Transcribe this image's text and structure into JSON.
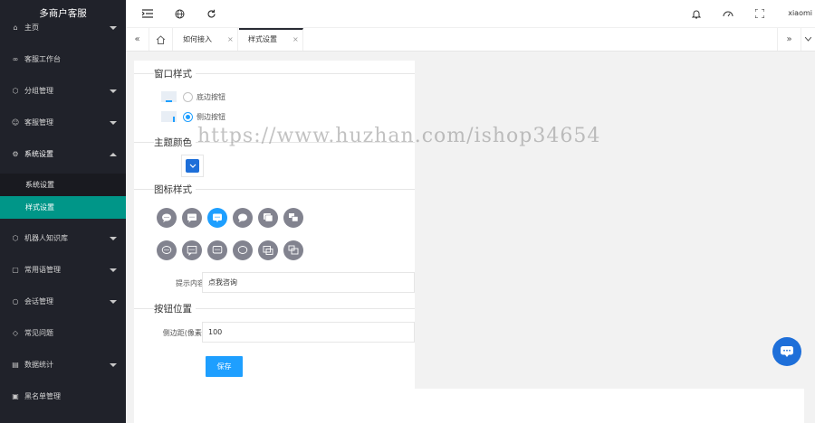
{
  "sidebar": {
    "logo": "多商户客服",
    "items": [
      {
        "label": "主页",
        "icon": "home-icon",
        "arrow": "down"
      },
      {
        "label": "客服工作台",
        "icon": "link-icon",
        "arrow": ""
      },
      {
        "label": "分组管理",
        "icon": "cube-icon",
        "arrow": "down"
      },
      {
        "label": "客服管理",
        "icon": "user-icon",
        "arrow": "down"
      },
      {
        "label": "系统设置",
        "icon": "gear-icon",
        "arrow": "up"
      },
      {
        "label": "机器人知识库",
        "icon": "cube-icon",
        "arrow": "down"
      },
      {
        "label": "常用语管理",
        "icon": "note-icon",
        "arrow": "down"
      },
      {
        "label": "会话管理",
        "icon": "chat-icon",
        "arrow": "down"
      },
      {
        "label": "常见问题",
        "icon": "shield-icon",
        "arrow": ""
      },
      {
        "label": "数据统计",
        "icon": "chart-icon",
        "arrow": "down"
      },
      {
        "label": "黑名单管理",
        "icon": "list-icon",
        "arrow": ""
      }
    ],
    "sub_items": [
      {
        "label": "系统设置",
        "active": false
      },
      {
        "label": "样式设置",
        "active": true
      }
    ]
  },
  "header": {
    "icons": [
      "menu-fold-icon",
      "globe-icon",
      "refresh-icon",
      "bell-icon",
      "theme-icon",
      "fullscreen-icon"
    ],
    "user": "xiaomi"
  },
  "tabs": [
    {
      "label": "如何接入",
      "close": "×"
    },
    {
      "label": "样式设置",
      "close": "×"
    }
  ],
  "form": {
    "window_style_title": "窗口样式",
    "radio_bottom": "底边按钮",
    "radio_side": "侧边按钮",
    "radio_selected": "侧边按钮",
    "theme_color_title": "主题颜色",
    "theme_color": "#1e6fd9",
    "icon_style_title": "图标样式",
    "selected_icon_index": 2,
    "hint_label": "提示内容",
    "hint_value": "点我咨询",
    "button_pos_title": "按钮位置",
    "side_distance_label": "侧边距(像素)",
    "side_distance_value": "100",
    "save_label": "保存"
  },
  "watermark": "https://www.huzhan.com/ishop34654",
  "colors": {
    "sidebar_bg": "#20222a",
    "active_sub": "#009688",
    "accent": "#1e9fff",
    "fab": "#1e6fd9"
  }
}
